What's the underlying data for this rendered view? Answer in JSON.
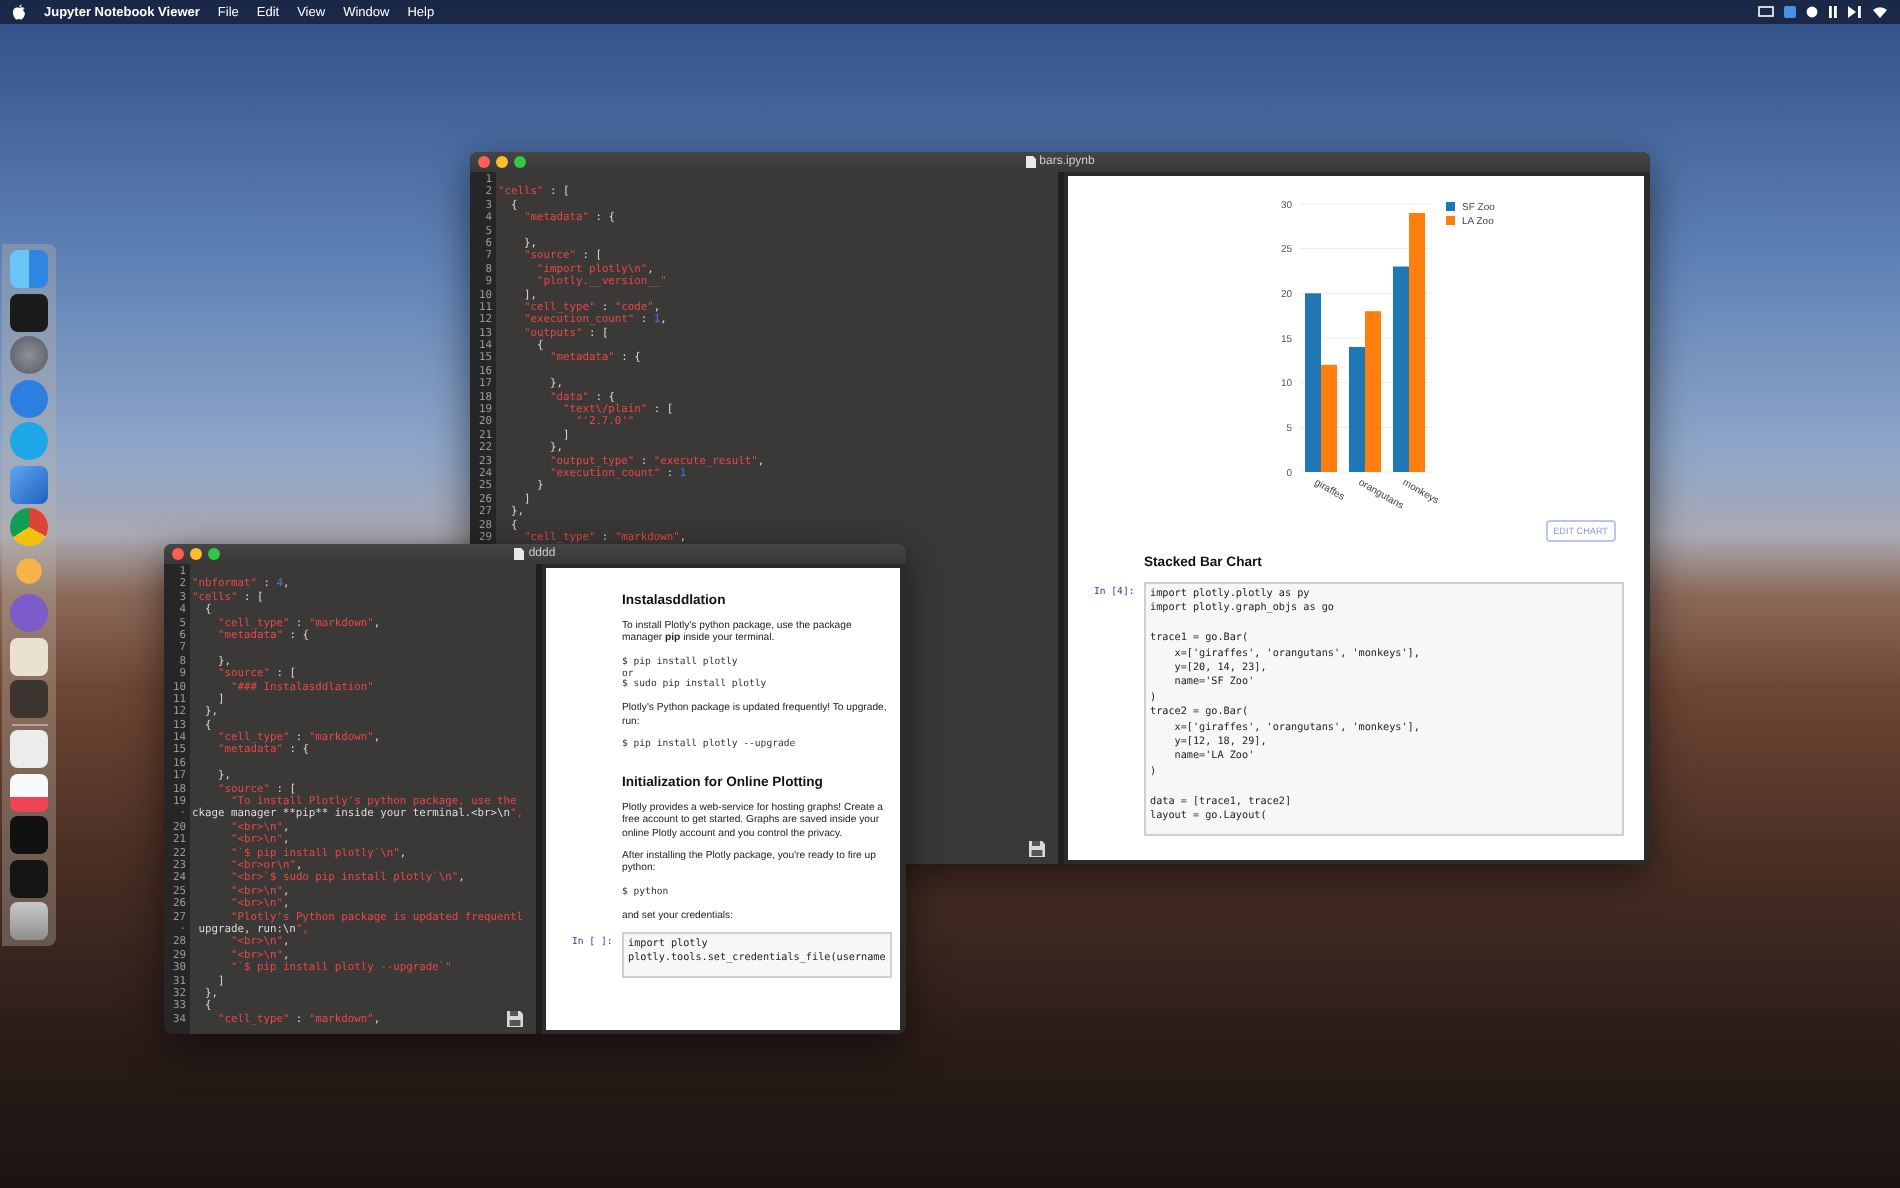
{
  "menubar": {
    "app_name": "Jupyter Notebook Viewer",
    "menus": [
      "File",
      "Edit",
      "View",
      "Window",
      "Help"
    ]
  },
  "windows": [
    {
      "title": "bars.ipynb",
      "editor_lines": [
        {
          "n": "1"
        },
        {
          "n": "2",
          "text": "\"cells\" : ["
        },
        {
          "n": "3",
          "text": "  {"
        },
        {
          "n": "4",
          "text": "    \"metadata\" : {"
        },
        {
          "n": "5"
        },
        {
          "n": "6",
          "text": "    },"
        },
        {
          "n": "7",
          "text": "    \"source\" : ["
        },
        {
          "n": "8",
          "text": "      \"import plotly\\n\","
        },
        {
          "n": "9",
          "text": "      \"plotly.__version__\""
        },
        {
          "n": "10",
          "text": "    ],"
        },
        {
          "n": "11",
          "text": "    \"cell_type\" : \"code\","
        },
        {
          "n": "12",
          "text": "    \"execution_count\" : 1,"
        },
        {
          "n": "13",
          "text": "    \"outputs\" : ["
        },
        {
          "n": "14",
          "text": "      {"
        },
        {
          "n": "15",
          "text": "        \"metadata\" : {"
        },
        {
          "n": "16"
        },
        {
          "n": "17",
          "text": "        },"
        },
        {
          "n": "18",
          "text": "        \"data\" : {"
        },
        {
          "n": "19",
          "text": "          \"text\\/plain\" : ["
        },
        {
          "n": "20",
          "text": "            \"'2.7.0'\""
        },
        {
          "n": "21",
          "text": "          ]"
        },
        {
          "n": "22",
          "text": "        },"
        },
        {
          "n": "23",
          "text": "        \"output_type\" : \"execute_result\","
        },
        {
          "n": "24",
          "text": "        \"execution_count\" : 1"
        },
        {
          "n": "25",
          "text": "      }"
        },
        {
          "n": "26",
          "text": "    ]"
        },
        {
          "n": "27",
          "text": "  },"
        },
        {
          "n": "28",
          "text": "  {"
        },
        {
          "n": "29",
          "text": "    \"cell_type\" : \"markdown\","
        }
      ],
      "notebook": [
        {
          "kind": "chart",
          "button": "EDIT CHART",
          "chart_data": {
            "type": "bar",
            "categories": [
              "giraffes",
              "orangutans",
              "monkeys"
            ],
            "series": [
              {
                "name": "SF Zoo",
                "color": "#1f77b4",
                "values": [
                  20,
                  14,
                  23
                ]
              },
              {
                "name": "LA Zoo",
                "color": "#ff7f0e",
                "values": [
                  12,
                  18,
                  29
                ]
              }
            ],
            "grid": true,
            "legend": true,
            "ylim": [
              0,
              30
            ],
            "yticks": [
              0,
              5,
              10,
              15,
              20,
              25,
              30
            ]
          }
        },
        {
          "kind": "heading",
          "text": "Stacked Bar Chart"
        },
        {
          "kind": "cell",
          "prompt": "In [4]:",
          "code": "import plotly.plotly as py\nimport plotly.graph_objs as go\n\ntrace1 = go.Bar(\n    x=['giraffes', 'orangutans', 'monkeys'],\n    y=[20, 14, 23],\n    name='SF Zoo'\n)\ntrace2 = go.Bar(\n    x=['giraffes', 'orangutans', 'monkeys'],\n    y=[12, 18, 29],\n    name='LA Zoo'\n)\n\ndata = [trace1, trace2]\nlayout = go.Layout("
        }
      ]
    },
    {
      "title": "dddd",
      "editor_lines": [
        {
          "n": "1"
        },
        {
          "n": "2",
          "text": "\"nbformat\" : 4,"
        },
        {
          "n": "3",
          "text": "\"cells\" : ["
        },
        {
          "n": "4",
          "text": "  {"
        },
        {
          "n": "5",
          "text": "    \"cell_type\" : \"markdown\","
        },
        {
          "n": "6",
          "text": "    \"metadata\" : {"
        },
        {
          "n": "7"
        },
        {
          "n": "8",
          "text": "    },"
        },
        {
          "n": "9",
          "text": "    \"source\" : ["
        },
        {
          "n": "10",
          "text": "      \"### Instalasddlation\""
        },
        {
          "n": "11",
          "text": "    ]"
        },
        {
          "n": "12",
          "text": "  },"
        },
        {
          "n": "13",
          "text": "  {"
        },
        {
          "n": "14",
          "text": "    \"cell_type\" : \"markdown\","
        },
        {
          "n": "15",
          "text": "    \"metadata\" : {"
        },
        {
          "n": "16"
        },
        {
          "n": "17",
          "text": "    },"
        },
        {
          "n": "18",
          "text": "    \"source\" : ["
        },
        {
          "n": "19",
          "text": "      \"To install Plotly's python package, use the"
        },
        {
          "n": "·",
          "text": "ckage manager **pip** inside your terminal.<br>\\n\","
        },
        {
          "n": "20",
          "text": "      \"<br>\\n\","
        },
        {
          "n": "21",
          "text": "      \"<br>\\n\","
        },
        {
          "n": "22",
          "text": "      \"`$ pip install plotly`\\n\","
        },
        {
          "n": "23",
          "text": "      \"<br>or\\n\","
        },
        {
          "n": "24",
          "text": "      \"<br>`$ sudo pip install plotly`\\n\","
        },
        {
          "n": "25",
          "text": "      \"<br>\\n\","
        },
        {
          "n": "26",
          "text": "      \"<br>\\n\","
        },
        {
          "n": "27",
          "text": "      \"Plotly's Python package is updated frequentl"
        },
        {
          "n": "·",
          "text": " upgrade, run:\\n\","
        },
        {
          "n": "28",
          "text": "      \"<br>\\n\","
        },
        {
          "n": "29",
          "text": "      \"<br>\\n\","
        },
        {
          "n": "30",
          "text": "      \"`$ pip install plotly --upgrade`\""
        },
        {
          "n": "31",
          "text": "    ]"
        },
        {
          "n": "32",
          "text": "  },"
        },
        {
          "n": "33",
          "text": "  {"
        },
        {
          "n": "34",
          "text": "    \"cell_type\" : \"markdown\","
        }
      ],
      "notebook": [
        {
          "kind": "heading",
          "text": "Instalasddlation"
        },
        {
          "kind": "para",
          "text": "To install Plotly's python package, use the package manager **pip** inside your terminal."
        },
        {
          "kind": "pre",
          "text": "$ pip install plotly\nor\n$ sudo pip install plotly"
        },
        {
          "kind": "para",
          "text": "Plotly's Python package is updated frequently! To upgrade, run:"
        },
        {
          "kind": "pre",
          "text": "$ pip install plotly --upgrade"
        },
        {
          "kind": "heading",
          "text": "Initialization for Online Plotting"
        },
        {
          "kind": "para",
          "text": "Plotly provides a web-service for hosting graphs! Create a free account to get started. Graphs are saved inside your online Plotly account and you control the privacy."
        },
        {
          "kind": "para",
          "text": "After installing the Plotly package, you're ready to fire up python:"
        },
        {
          "kind": "pre",
          "text": "$ python"
        },
        {
          "kind": "para",
          "text": "and set your credentials:"
        },
        {
          "kind": "cell",
          "prompt": "In [ ]:",
          "code": "import plotly\nplotly.tools.set_credentials_file(username"
        }
      ]
    }
  ]
}
